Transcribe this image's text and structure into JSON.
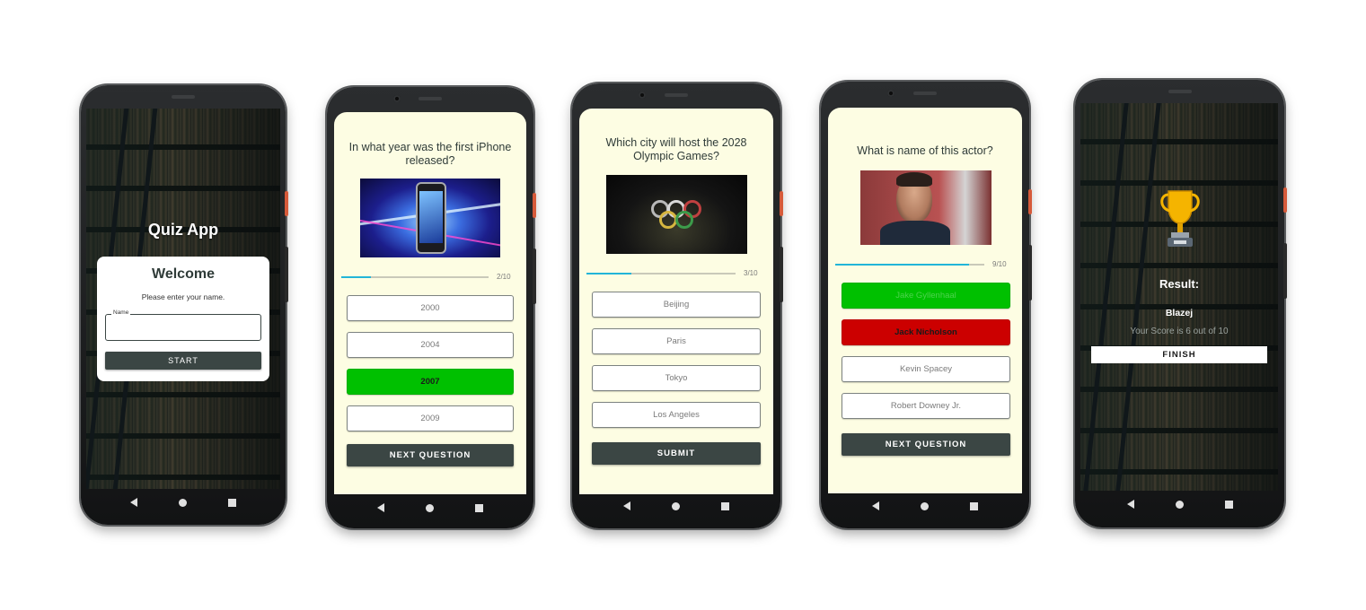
{
  "colors": {
    "quiz_background": "#fdfde3",
    "dark_button": "#3b4644",
    "correct": "#00c000",
    "wrong": "#cc0000",
    "progress": "#22b5d8"
  },
  "navbar": {
    "back_icon": "back-triangle-icon",
    "home_icon": "home-circle-icon",
    "recents_icon": "recents-square-icon"
  },
  "welcome_screen": {
    "app_title": "Quiz App",
    "card_title": "Welcome",
    "prompt": "Please enter your name.",
    "name_label": "Name",
    "name_value": "",
    "start_label": "START"
  },
  "screen_question_2": {
    "question": "In what year was the first iPhone released?",
    "progress_label": "2/10",
    "progress_value": 0.2,
    "options": [
      "2000",
      "2004",
      "2007",
      "2009"
    ],
    "selected_correct": "2007",
    "button_label": "NEXT QUESTION"
  },
  "screen_question_3": {
    "question": "Which city will host the 2028 Olympic Games?",
    "progress_label": "3/10",
    "progress_value": 0.3,
    "options": [
      "Beijing",
      "Paris",
      "Tokyo",
      "Los Angeles"
    ],
    "button_label": "SUBMIT"
  },
  "screen_question_9": {
    "question": "What is name of this actor?",
    "progress_label": "9/10",
    "progress_value": 0.9,
    "options": [
      "Jake Gyllenhaal",
      "Jack Nicholson",
      "Kevin Spacey",
      "Robert Downey Jr."
    ],
    "correct_option": "Jake Gyllenhaal",
    "wrong_option": "Jack Nicholson",
    "button_label": "NEXT QUESTION"
  },
  "result_screen": {
    "trophy_icon": "trophy-icon",
    "result_label": "Result:",
    "player_name": "Blazej",
    "score_text": "Your Score is 6 out of 10",
    "finish_label": "FINISH"
  }
}
